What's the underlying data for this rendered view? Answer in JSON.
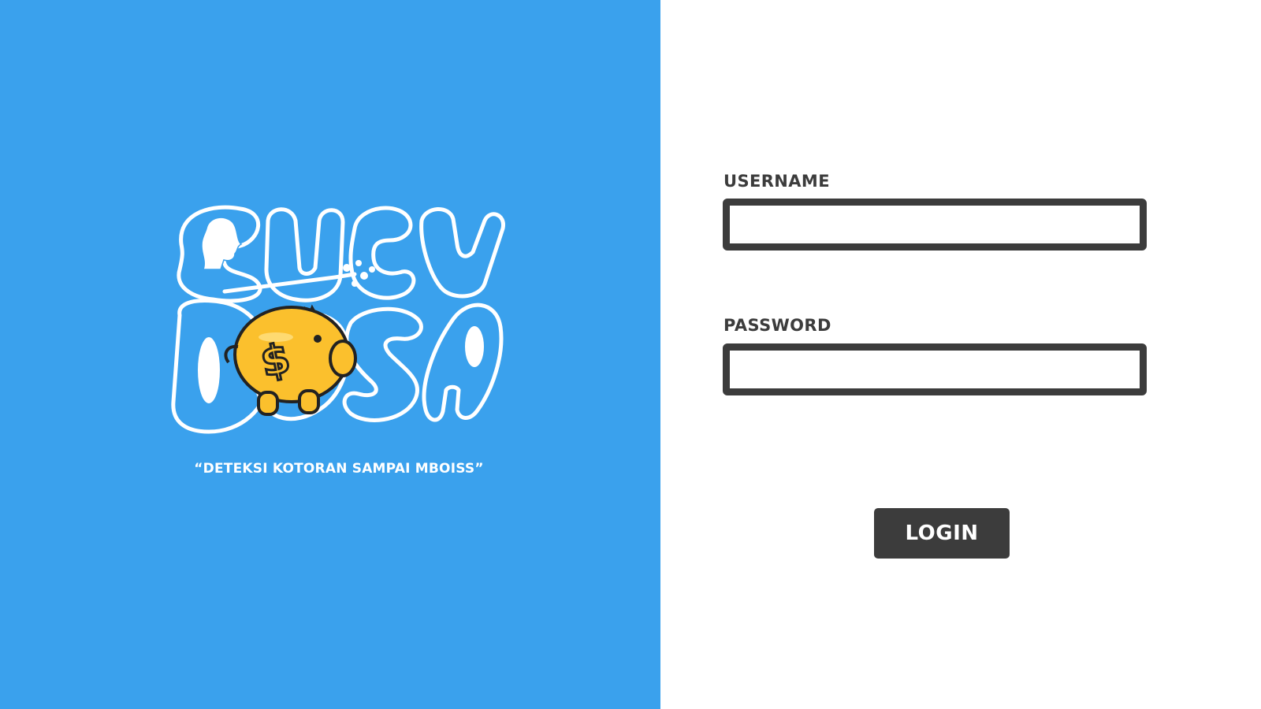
{
  "brand": {
    "logo_name": "cuci-dosa-logo",
    "tagline": "“DETEKSI KOTORAN SAMPAI MBOISS”",
    "colors": {
      "background": "#3aa1ed",
      "logo_outline": "#ffffff",
      "piggy_bank": "#fbc02d"
    }
  },
  "login_form": {
    "username_label": "USERNAME",
    "username_value": "",
    "password_label": "PASSWORD",
    "password_value": "",
    "login_label": "LOGIN",
    "colors": {
      "field_border": "#3c3c3c",
      "button_bg": "#3c3c3c",
      "button_text": "#ffffff"
    }
  }
}
